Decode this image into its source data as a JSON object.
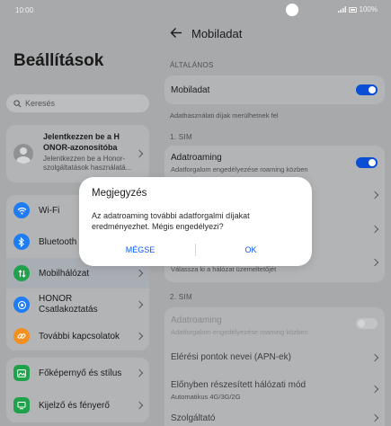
{
  "status_bar": {
    "time": "10:00",
    "battery": "100%"
  },
  "left_pane": {
    "title": "Beállítások",
    "search_placeholder": "Keresés",
    "account": {
      "title": "Jelentkezzen be a H ONOR-azonosítóba",
      "subtitle": "Jelentkezzen be a Honor-szolgáltatások használatá..."
    },
    "items": [
      {
        "label": "Wi-Fi",
        "icon": "wifi-icon",
        "color": "#1f7cf5"
      },
      {
        "label": "Bluetooth",
        "icon": "bluetooth-icon",
        "color": "#1f7cf5"
      },
      {
        "label": "Mobilhálózat",
        "icon": "mobile-network-icon",
        "color": "#1fa24b",
        "selected": true
      },
      {
        "label": "HONOR Csatlakoztatás",
        "icon": "honor-connect-icon",
        "color": "#1f7cf5"
      },
      {
        "label": "További kapcsolatok",
        "icon": "link-icon",
        "color": "#f29020"
      },
      {
        "label": "Főképernyő és stílus",
        "icon": "home-screen-icon",
        "color": "#1fa24b"
      },
      {
        "label": "Kijelző és fényerő",
        "icon": "display-icon",
        "color": "#1fa24b"
      }
    ]
  },
  "right_pane": {
    "title": "Mobiladat",
    "general_header": "ÁLTALÁNOS",
    "mobile_data": {
      "label": "Mobiladat",
      "on": true
    },
    "fees_note": "Adathasználati díjak merülhetnek fel",
    "sim1_header": "1. SIM",
    "sim1_roaming": {
      "title": "Adatroaming",
      "subtitle": "Adatforgalom engedélyezése roaming közben",
      "on": true
    },
    "sim1_network_subtitle": "Válassza ki a hálózat üzemeltetőjét",
    "sim2_header": "2. SIM",
    "sim2_roaming": {
      "title": "Adatroaming",
      "subtitle": "Adatforgalom engedélyezése roaming közben",
      "on": false
    },
    "sim2_apn": "Elérési pontok nevei (APN-ek)",
    "sim2_preferred": {
      "title": "Előnyben részesített hálózati mód",
      "subtitle": "Automatikus 4G/3G/2G"
    },
    "sim2_provider": "Szolgáltató"
  },
  "dialog": {
    "title": "Megjegyzés",
    "message": "Az adatroaming további adatforgalmi díjakat eredményezhet. Mégis engedélyezi?",
    "cancel": "MÉGSE",
    "ok": "OK"
  },
  "colors": {
    "accent": "#0a59f7",
    "toggle_on": "#0a4ed6",
    "dim_overlay": "#a7a9ab"
  }
}
